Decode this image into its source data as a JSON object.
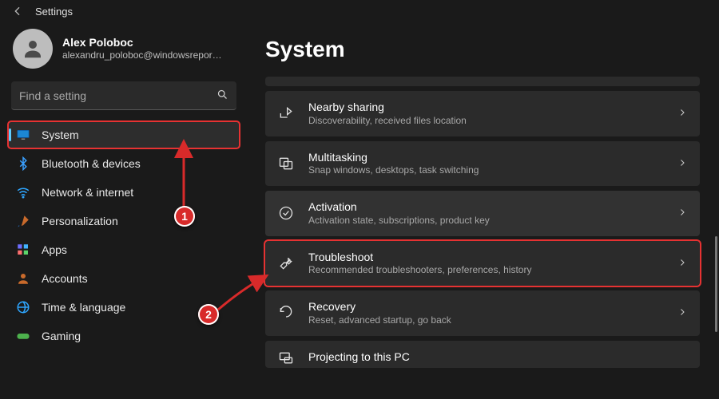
{
  "app_title": "Settings",
  "user": {
    "name": "Alex Poloboc",
    "email": "alexandru_poloboc@windowsreport..."
  },
  "search": {
    "placeholder": "Find a setting"
  },
  "sidebar": {
    "items": [
      {
        "label": "System"
      },
      {
        "label": "Bluetooth & devices"
      },
      {
        "label": "Network & internet"
      },
      {
        "label": "Personalization"
      },
      {
        "label": "Apps"
      },
      {
        "label": "Accounts"
      },
      {
        "label": "Time & language"
      },
      {
        "label": "Gaming"
      }
    ]
  },
  "main": {
    "title": "System",
    "tiles": [
      {
        "title": "Nearby sharing",
        "sub": "Discoverability, received files location"
      },
      {
        "title": "Multitasking",
        "sub": "Snap windows, desktops, task switching"
      },
      {
        "title": "Activation",
        "sub": "Activation state, subscriptions, product key"
      },
      {
        "title": "Troubleshoot",
        "sub": "Recommended troubleshooters, preferences, history"
      },
      {
        "title": "Recovery",
        "sub": "Reset, advanced startup, go back"
      },
      {
        "title": "Projecting to this PC",
        "sub": ""
      }
    ]
  },
  "annotations": {
    "step1": "1",
    "step2": "2"
  },
  "colors": {
    "accent": "#60cdff",
    "highlight": "#e63232"
  }
}
